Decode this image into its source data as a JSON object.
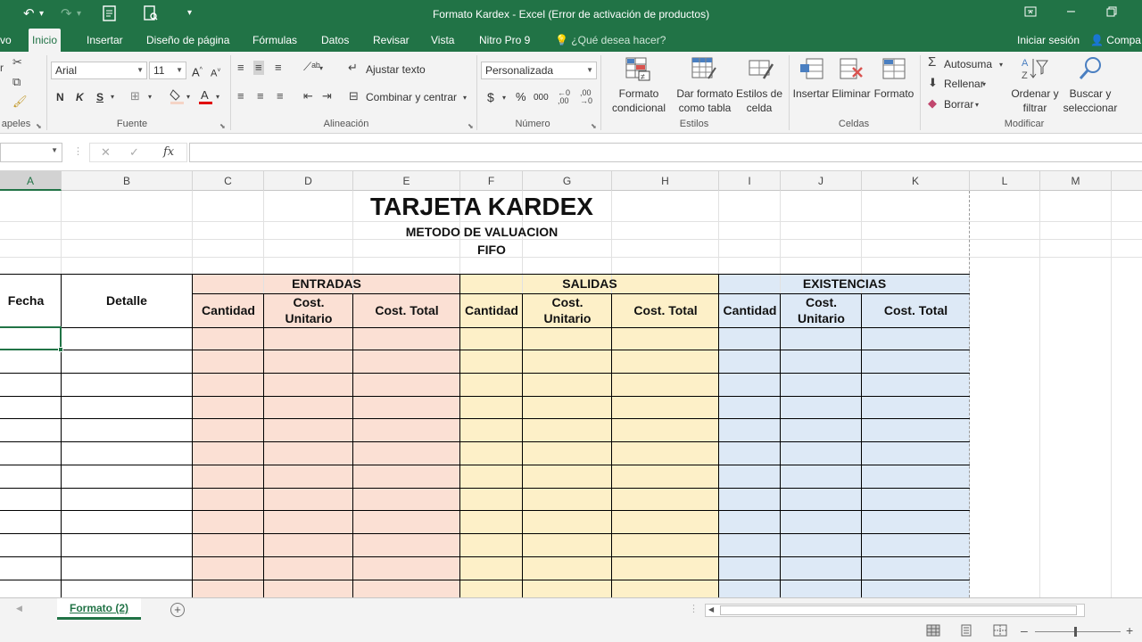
{
  "window": {
    "title": "Formato Kardex - Excel (Error de activación de productos)"
  },
  "tabs": [
    "vo",
    "Inicio",
    "Insertar",
    "Diseño de página",
    "Fórmulas",
    "Datos",
    "Revisar",
    "Vista",
    "Nitro Pro 9"
  ],
  "active_tab": "Inicio",
  "tell_me": "¿Qué desea hacer?",
  "sign_in": "Iniciar sesión",
  "share": "Compa",
  "ribbon": {
    "clipboard_label": "apeles",
    "font_name": "Arial",
    "font_size": "11",
    "font_label": "Fuente",
    "bold": "N",
    "italic": "K",
    "underline": "S",
    "wrap_text": "Ajustar texto",
    "merge_center": "Combinar y centrar",
    "alignment_label": "Alineación",
    "number_format": "Personalizada",
    "number_label": "Número",
    "currency_symbol": "$",
    "percent_symbol": "%",
    "thousands_symbol": "000",
    "cond_format_1": "Formato",
    "cond_format_2": "condicional",
    "table_format_1": "Dar formato",
    "table_format_2": "como tabla",
    "cell_styles_1": "Estilos de",
    "cell_styles_2": "celda",
    "styles_label": "Estilos",
    "insert": "Insertar",
    "delete": "Eliminar",
    "format": "Formato",
    "cells_label": "Celdas",
    "autosum": "Autosuma",
    "fill": "Rellenar",
    "clear": "Borrar",
    "sort_1": "Ordenar y",
    "sort_2": "filtrar",
    "find_1": "Buscar y",
    "find_2": "seleccionar",
    "modify_label": "Modificar"
  },
  "formula_bar": {
    "fx": "fx",
    "value": ""
  },
  "columns": [
    "A",
    "B",
    "C",
    "D",
    "E",
    "F",
    "G",
    "H",
    "I",
    "J",
    "K",
    "L",
    "M"
  ],
  "kardex": {
    "title": "TARJETA KARDEX",
    "subtitle": "METODO DE VALUACION",
    "method": "FIFO",
    "col_fecha": "Fecha",
    "col_detalle": "Detalle",
    "group_entradas": "ENTRADAS",
    "group_salidas": "SALIDAS",
    "group_existencias": "EXISTENCIAS",
    "col_cantidad": "Cantidad",
    "col_cost_unit_1": "Cost.",
    "col_cost_unit_2": "Unitario",
    "col_cost_total": "Cost. Total",
    "colors": {
      "entradas": "#fbe0d4",
      "salidas": "#fdf0c8",
      "existencias": "#dde9f6"
    }
  },
  "sheet_tab": "Formato (2)"
}
